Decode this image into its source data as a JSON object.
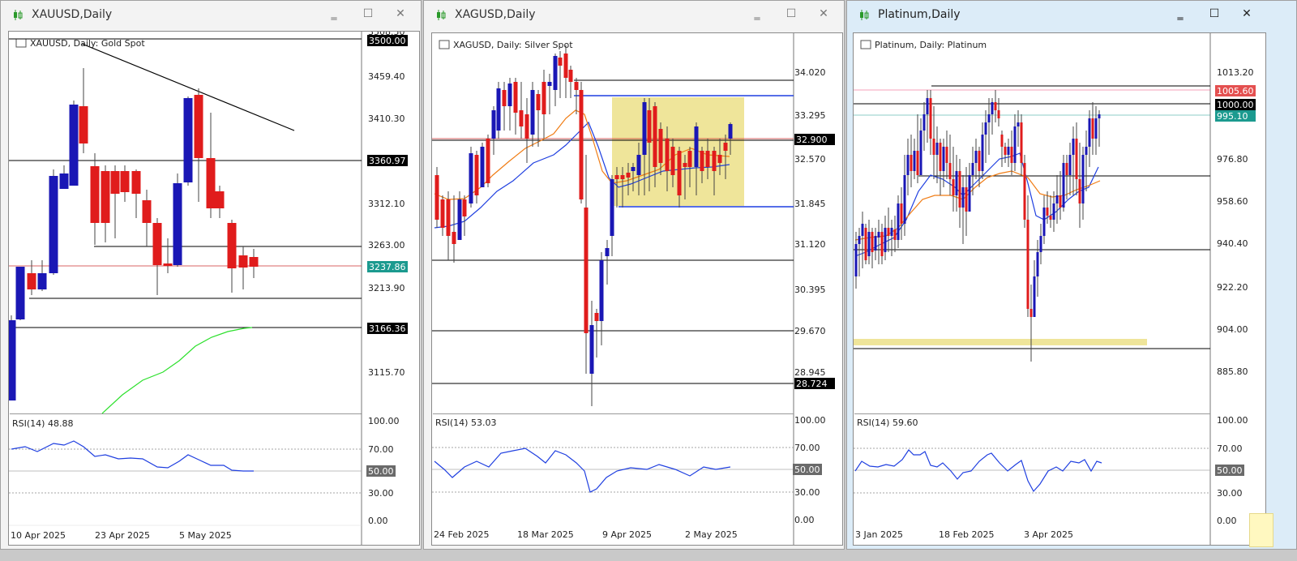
{
  "windows": [
    {
      "title": "XAUUSD,Daily",
      "legend": "XAUUSD, Daily:  Gold Spot",
      "price_labels": [
        "3508.50",
        "3459.40",
        "3410.30",
        "3312.10",
        "3263.00",
        "3213.90",
        "3115.70"
      ],
      "price_tags": [
        {
          "text": "3500.00",
          "kind": "black"
        },
        {
          "text": "3360.97",
          "kind": "black"
        },
        {
          "text": "3237.86",
          "kind": "teal"
        },
        {
          "text": "3166.36",
          "kind": "black"
        }
      ],
      "rsi_label": "RSI(14) 48.88",
      "rsi_levels": [
        "100.00",
        "70.00",
        "50.00",
        "30.00",
        "0.00"
      ],
      "dates": [
        "10 Apr 2025",
        "23 Apr 2025",
        "5 May 2025"
      ]
    },
    {
      "title": "XAGUSD,Daily",
      "legend": "XAGUSD, Daily:  Silver Spot",
      "price_labels": [
        "34.020",
        "33.295",
        "32.570",
        "31.845",
        "31.120",
        "30.395",
        "29.670",
        "28.945"
      ],
      "price_tags": [
        {
          "text": "32.900",
          "kind": "black"
        },
        {
          "text": "28.724",
          "kind": "black"
        }
      ],
      "rsi_label": "RSI(14) 53.03",
      "rsi_levels": [
        "100.00",
        "70.00",
        "50.00",
        "30.00",
        "0.00"
      ],
      "dates": [
        "24 Feb 2025",
        "18 Mar 2025",
        "9 Apr 2025",
        "2 May 2025"
      ]
    },
    {
      "title": "Platinum,Daily",
      "legend": "Platinum, Daily:  Platinum",
      "price_labels": [
        "1013.20",
        "976.80",
        "958.60",
        "940.40",
        "922.20",
        "904.00",
        "885.80"
      ],
      "price_tags": [
        {
          "text": "1005.60",
          "kind": "red"
        },
        {
          "text": "1000.00",
          "kind": "black"
        },
        {
          "text": "995.10",
          "kind": "teal"
        }
      ],
      "rsi_label": "RSI(14) 59.60",
      "rsi_levels": [
        "100.00",
        "70.00",
        "50.00",
        "30.00",
        "0.00"
      ],
      "dates": [
        "3 Jan 2025",
        "18 Feb 2025",
        "3 Apr 2025"
      ]
    }
  ],
  "colors": {
    "bull": "#1a17b5",
    "bear": "#e01c1c",
    "ma_blue": "#1f3fe0",
    "ma_orange": "#f07c14",
    "ma_green": "#2ce02c",
    "zone": "#efe59a",
    "teal": "#1b9a8f",
    "red_tag": "#e45050"
  }
}
